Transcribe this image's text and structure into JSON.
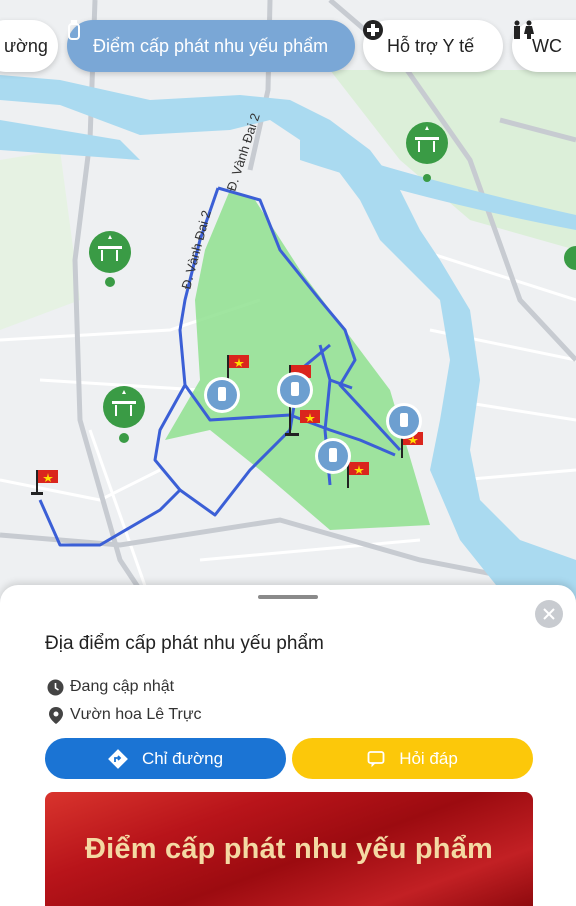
{
  "filters": [
    {
      "label": "ường",
      "icon": "route-icon",
      "active": false
    },
    {
      "label": "Điểm cấp phát nhu yếu phẩm",
      "icon": "water-bottle-icon",
      "active": true
    },
    {
      "label": "Hỗ trợ Y tế",
      "icon": "medical-cross-icon",
      "active": false
    },
    {
      "label": "WC",
      "icon": "restroom-icon",
      "active": false
    }
  ],
  "map": {
    "road_label": "Đ. Vành Đai 2",
    "colors": {
      "river": "#aadaf0",
      "park": "#8fe08f",
      "route": "#3b5fd6",
      "marker": "#6d9fd0",
      "landmark": "#3a9b45"
    }
  },
  "sheet": {
    "title": "Địa điểm cấp phát nhu yếu phẩm",
    "status": "Đang cập nhật",
    "location": "Vườn hoa Lê Trực",
    "directions_label": "Chỉ đường",
    "qa_label": "Hỏi đáp",
    "banner_text": "Điểm cấp phát nhu yếu phẩm",
    "colors": {
      "directions": "#1b74d4",
      "qa": "#fcc80a",
      "banner": "#b8141a"
    }
  }
}
